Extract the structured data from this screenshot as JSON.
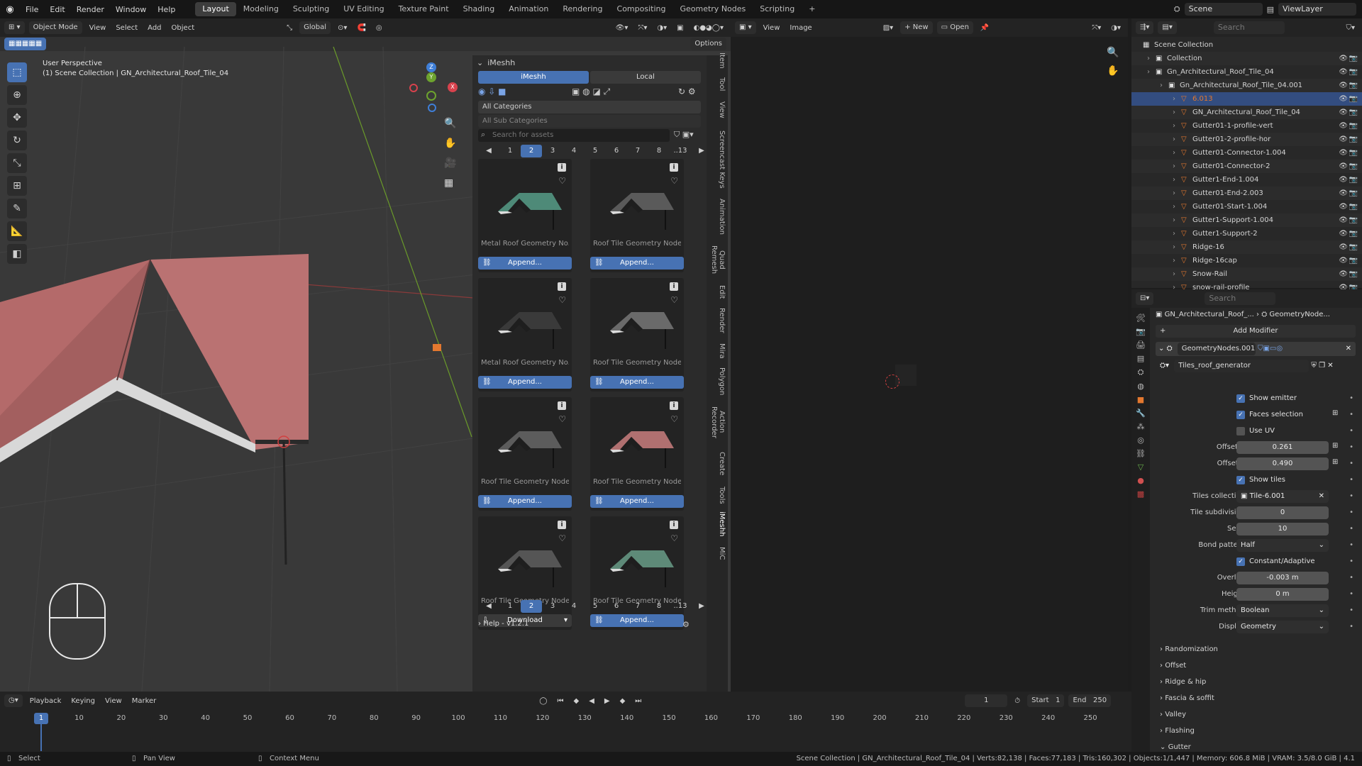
{
  "topbar": {
    "menus": [
      "File",
      "Edit",
      "Render",
      "Window",
      "Help"
    ],
    "workspaces": [
      "Layout",
      "Modeling",
      "Sculpting",
      "UV Editing",
      "Texture Paint",
      "Shading",
      "Animation",
      "Rendering",
      "Compositing",
      "Geometry Nodes",
      "Scripting"
    ],
    "active_workspace": "Layout",
    "add_tab": "+",
    "scene": "Scene",
    "view_layer": "ViewLayer"
  },
  "viewport": {
    "mode": "Object Mode",
    "menus": [
      "View",
      "Select",
      "Add",
      "Object"
    ],
    "orientation": "Global",
    "options": "Options",
    "perspective_label": "User Perspective",
    "collection_label": "(1) Scene Collection | GN_Architectural_Roof_Tile_04",
    "roof_color": "#b46a6a",
    "axis_x": "X",
    "axis_y": "Y",
    "axis_z": "Z"
  },
  "imeshh": {
    "title": "iMeshh",
    "tab_imeshh": "iMeshh",
    "tab_local": "Local",
    "category": "All Categories",
    "subcategory": "All Sub Categories",
    "search_placeholder": "Search for assets",
    "pages": [
      "1",
      "2",
      "3",
      "4",
      "5",
      "6",
      "7",
      "8",
      "..13"
    ],
    "current_page": "2",
    "assets": [
      {
        "name": "Metal Roof Geometry No...",
        "action": "Append...",
        "roof_color": "#4e8a78"
      },
      {
        "name": "Roof Tile Geometry Node...",
        "action": "Append...",
        "roof_color": "#5a5a5a"
      },
      {
        "name": "Metal Roof Geometry No...",
        "action": "Append...",
        "roof_color": "#3a3a3a"
      },
      {
        "name": "Roof Tile Geometry Node...",
        "action": "Append...",
        "roof_color": "#6a6a6a"
      },
      {
        "name": "Roof Tile Geometry Node...",
        "action": "Append...",
        "roof_color": "#5c5c5c"
      },
      {
        "name": "Roof Tile Geometry Node...",
        "action": "Append...",
        "roof_color": "#b07070"
      },
      {
        "name": "Roof Tile Geometry Node...",
        "action": "Download",
        "roof_color": "#555555"
      },
      {
        "name": "Roof Tile Geometry Node...",
        "action": "Append...",
        "roof_color": "#5e8a78"
      }
    ],
    "help": "Help - v1.2.1",
    "vtabs": [
      "Item",
      "Tool",
      "View",
      "Screencast Keys",
      "Animation",
      "Quad Remesh",
      "Edit",
      "Render",
      "Mira",
      "Polygon",
      "Action Recorder",
      "Create",
      "Tools",
      "iMeshh",
      "MiC"
    ]
  },
  "image_editor": {
    "menus": [
      "View",
      "Image"
    ],
    "new_label": "New",
    "open_label": "Open"
  },
  "outliner": {
    "search_placeholder": "Search",
    "rows": [
      {
        "label": "Scene Collection",
        "indent": 0
      },
      {
        "label": "Collection",
        "indent": 1
      },
      {
        "label": "Gn_Architectural_Roof_Tile_04",
        "indent": 1
      },
      {
        "label": "Gn_Architectural_Roof_Tile_04.001",
        "indent": 2
      },
      {
        "label": "6.013",
        "indent": 3,
        "accent": "#e3782f"
      },
      {
        "label": "GN_Architectural_Roof_Tile_04",
        "indent": 3
      },
      {
        "label": "Gutter01-1-profile-vert",
        "indent": 3
      },
      {
        "label": "Gutter01-2-profile-hor",
        "indent": 3
      },
      {
        "label": "Gutter01-Connector-1.004",
        "indent": 3
      },
      {
        "label": "Gutter01-Connector-2",
        "indent": 3
      },
      {
        "label": "Gutter1-End-1.004",
        "indent": 3
      },
      {
        "label": "Gutter01-End-2.003",
        "indent": 3
      },
      {
        "label": "Gutter01-Start-1.004",
        "indent": 3
      },
      {
        "label": "Gutter1-Support-1.004",
        "indent": 3
      },
      {
        "label": "Gutter1-Support-2",
        "indent": 3
      },
      {
        "label": "Ridge-16",
        "indent": 3
      },
      {
        "label": "Ridge-16cap",
        "indent": 3
      },
      {
        "label": "Snow-Rail",
        "indent": 3
      },
      {
        "label": "snow-rail-profile",
        "indent": 3
      }
    ]
  },
  "properties": {
    "search_placeholder": "Search",
    "breadcrumb_object": "GN_Architectural_Roof_...",
    "breadcrumb_modifier": "GeometryNode...",
    "add_modifier": "Add Modifier",
    "modifier_name": "GeometryNodes.001",
    "node_group": "Tiles_roof_generator",
    "fields": [
      {
        "type": "check",
        "label": "Show emitter",
        "checked": true
      },
      {
        "type": "check",
        "label": "Faces selection",
        "checked": true
      },
      {
        "type": "check",
        "label": "Use UV",
        "checked": false
      },
      {
        "type": "value",
        "label": "Offset X",
        "value": "0.261"
      },
      {
        "type": "value",
        "label": "Offset Y",
        "value": "0.490"
      },
      {
        "type": "check",
        "label": "Show tiles",
        "checked": true
      },
      {
        "type": "object",
        "label": "Tiles collection",
        "value": "Tile-6.001"
      },
      {
        "type": "value",
        "label": "Tile subdivision",
        "value": "0"
      },
      {
        "type": "value",
        "label": "Seed",
        "value": "10"
      },
      {
        "type": "dropdown",
        "label": "Bond pattern",
        "value": "Half"
      },
      {
        "type": "check",
        "label": "Constant/Adaptive",
        "checked": true
      },
      {
        "type": "value",
        "label": "Overlap",
        "value": "-0.003 m"
      },
      {
        "type": "value",
        "label": "Height",
        "value": "0 m"
      },
      {
        "type": "dropdown",
        "label": "Trim method",
        "value": "Boolean"
      },
      {
        "type": "dropdown",
        "label": "Display",
        "value": "Geometry"
      }
    ],
    "sections": [
      "Randomization",
      "Offset",
      "Ridge & hip",
      "Fascia & soffit",
      "Valley",
      "Flashing",
      "Gutter"
    ]
  },
  "timeline": {
    "menus": [
      "Playback",
      "Keying",
      "View",
      "Marker"
    ],
    "current_frame": "1",
    "start_label": "Start",
    "start": "1",
    "end_label": "End",
    "end": "250",
    "ticks": [
      "1",
      "10",
      "20",
      "30",
      "40",
      "50",
      "60",
      "70",
      "80",
      "90",
      "100",
      "110",
      "120",
      "130",
      "140",
      "150",
      "160",
      "170",
      "180",
      "190",
      "200",
      "210",
      "220",
      "230",
      "240",
      "250"
    ]
  },
  "statusbar": {
    "select": "Select",
    "pan": "Pan View",
    "context": "Context Menu",
    "stats": "Scene Collection | GN_Architectural_Roof_Tile_04 | Verts:82,138 | Faces:77,183 | Tris:160,302 | Objects:1/1,447 | Memory: 606.8 MiB | VRAM: 3.5/8.0 GiB | 4.1"
  }
}
